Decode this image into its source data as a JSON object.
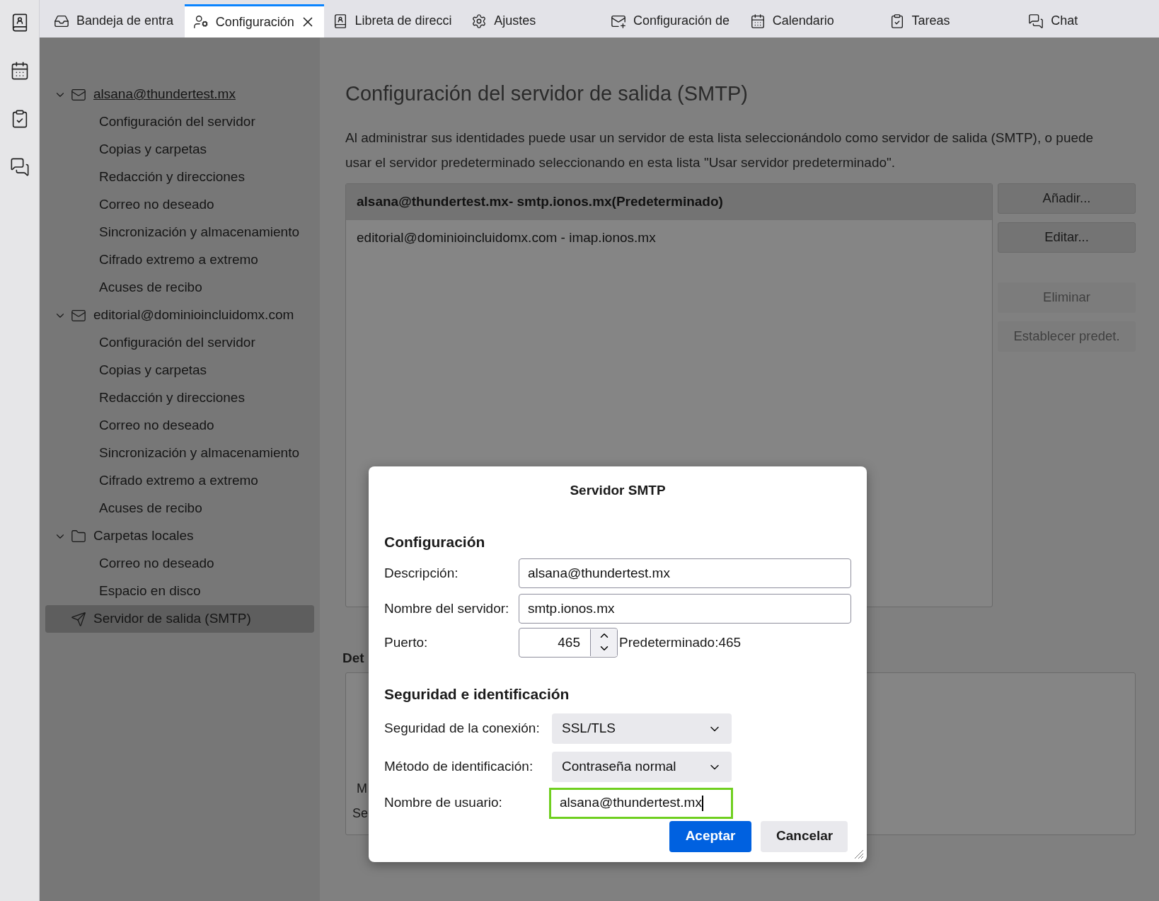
{
  "tabs": [
    {
      "kind": "inbox",
      "label": "Bandeja de entra",
      "selected": false
    },
    {
      "kind": "account",
      "label": "Configuración",
      "selected": true
    },
    {
      "kind": "addressbook",
      "label": "Libreta de direcci",
      "selected": false
    },
    {
      "kind": "settings",
      "label": "Ajustes",
      "selected": false
    },
    {
      "kind": "mailsettings",
      "label": "Configuración de",
      "selected": false
    },
    {
      "kind": "calendar",
      "label": "Calendario",
      "selected": false
    },
    {
      "kind": "tasks",
      "label": "Tareas",
      "selected": false
    },
    {
      "kind": "chat",
      "label": "Chat",
      "selected": false
    }
  ],
  "account_tree": [
    {
      "kind": "account",
      "label": "alsana@thundertest.mx",
      "focused": true,
      "expanded": true,
      "selected": false,
      "children": [
        {
          "label": "Configuración del servidor",
          "selected": false
        },
        {
          "label": "Copias y carpetas",
          "selected": false
        },
        {
          "label": "Redacción y direcciones",
          "selected": false
        },
        {
          "label": "Correo no deseado",
          "selected": false
        },
        {
          "label": "Sincronización y almacenamiento",
          "selected": false
        },
        {
          "label": "Cifrado extremo a extremo",
          "selected": false
        },
        {
          "label": "Acuses de recibo",
          "selected": false
        }
      ]
    },
    {
      "kind": "account",
      "label": "editorial@dominioincluidomx.com",
      "focused": false,
      "expanded": true,
      "selected": false,
      "children": [
        {
          "label": "Configuración del servidor",
          "selected": false
        },
        {
          "label": "Copias y carpetas",
          "selected": false
        },
        {
          "label": "Redacción y direcciones",
          "selected": false
        },
        {
          "label": "Correo no deseado",
          "selected": false
        },
        {
          "label": "Sincronización y almacenamiento",
          "selected": false
        },
        {
          "label": "Cifrado extremo a extremo",
          "selected": false
        },
        {
          "label": "Acuses de recibo",
          "selected": false
        }
      ]
    },
    {
      "kind": "folder",
      "label": "Carpetas locales",
      "focused": false,
      "expanded": true,
      "selected": false,
      "children": [
        {
          "label": "Correo no deseado",
          "selected": false
        },
        {
          "label": "Espacio en disco",
          "selected": false
        }
      ]
    },
    {
      "kind": "smtp",
      "label": "Servidor de salida (SMTP)",
      "focused": false,
      "selected": true
    }
  ],
  "content": {
    "title": "Configuración del servidor de salida (SMTP)",
    "description": "Al administrar sus identidades puede usar un servidor de esta lista seleccionándolo como servidor de salida (SMTP), o puede usar el servidor predeterminado seleccionando en esta lista \"Usar servidor predeterminado\".",
    "servers": [
      {
        "label": "alsana@thundertest.mx- smtp.ionos.mx(Predeterminado)",
        "selected": true,
        "default": true
      },
      {
        "label": "editorial@dominioincluidomx.com - imap.ionos.mx",
        "selected": false,
        "default": false
      }
    ],
    "buttons": [
      {
        "label": "Añadir...",
        "disabled": false
      },
      {
        "label": "Editar...",
        "disabled": false
      },
      {
        "label": "Eliminar",
        "disabled": true
      },
      {
        "label": "Establecer predet.",
        "disabled": true
      }
    ],
    "details_heading": "Det",
    "details_lines": [
      "M",
      "Se"
    ]
  },
  "dialog": {
    "title": "Servidor SMTP",
    "section_1": "Configuración",
    "fields": [
      {
        "label": "Descripción:",
        "value": "alsana@thundertest.mx"
      },
      {
        "label": "Nombre del servidor:",
        "value": "smtp.ionos.mx"
      }
    ],
    "port": {
      "label": "Puerto:",
      "value": "465",
      "hint": "Predeterminado:465"
    },
    "section_2": "Seguridad e identificación",
    "selects": [
      {
        "label": "Seguridad de la conexión:",
        "value": "SSL/TLS"
      },
      {
        "label": "Método de identificación:",
        "value": "Contraseña normal"
      }
    ],
    "username": {
      "label": "Nombre de usuario:",
      "value": "alsana@thundertest.mx",
      "focused": true
    },
    "buttons": [
      {
        "label": "Aceptar",
        "primary": true
      },
      {
        "label": "Cancelar",
        "primary": false
      }
    ]
  }
}
